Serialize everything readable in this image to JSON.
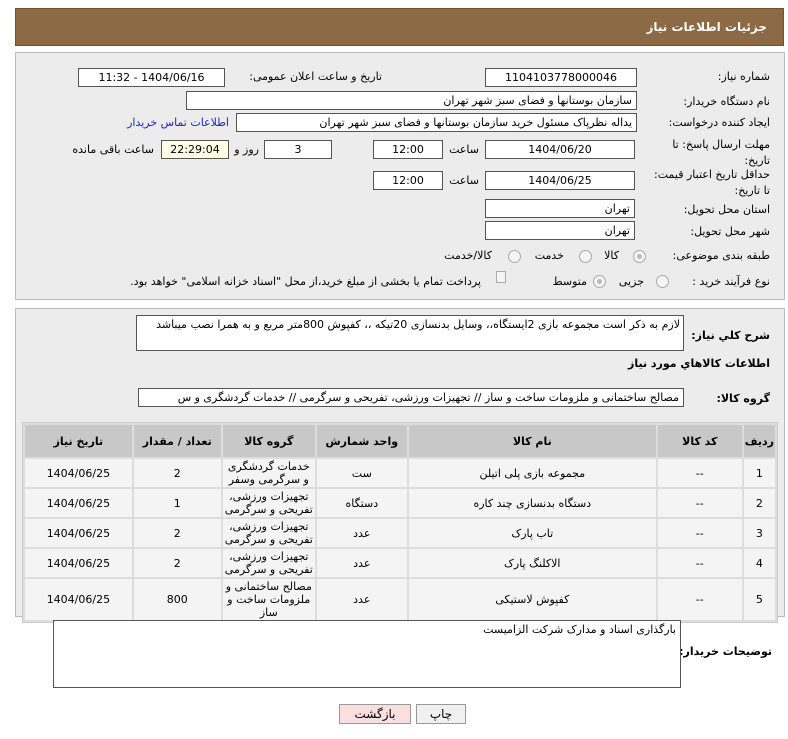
{
  "header": {
    "title": "جزئیات اطلاعات نیاز"
  },
  "form": {
    "need_number_label": "شماره نیاز:",
    "need_number": "1104103778000046",
    "announce_label": "تاریخ و ساعت اعلان عمومی:",
    "announce_value": "1404/06/16 - 11:32",
    "buyer_label": "نام دستگاه خریدار:",
    "buyer": "سازمان بوستانها و فضای سبز شهر تهران",
    "creator_label": "ایجاد کننده درخواست:",
    "creator": "یداله نظرپاک مسئول خرید سازمان بوستانها و فضای سبز شهر تهران",
    "contact_link": "اطلاعات تماس خریدار",
    "deadline_label": "مهلت ارسال پاسخ: تا تاریخ:",
    "deadline_date": "1404/06/20",
    "time_label": "ساعت",
    "deadline_time": "12:00",
    "days": "3",
    "days_label": "روز و",
    "remaining": "22:29:04",
    "remaining_label": "ساعت باقی مانده",
    "validity_label": "حداقل تاریخ اعتبار قیمت: تا تاریخ:",
    "validity_date": "1404/06/25",
    "validity_time": "12:00",
    "province_label": "استان محل تحویل:",
    "province": "تهران",
    "city_label": "شهر محل تحویل:",
    "city": "تهران",
    "category_label": "طبقه بندی موضوعی:",
    "category_options": [
      "کالا",
      "خدمت",
      "کالا/خدمت"
    ],
    "process_label": "نوع فرآیند خرید :",
    "process_options": [
      "جزیی",
      "متوسط"
    ],
    "payment_note": "پرداخت تمام یا بخشی از مبلغ خرید،از محل \"اسناد خزانه اسلامی\" خواهد بود."
  },
  "details": {
    "desc_label": "شرح کلي نیاز:",
    "desc": "لازم به ذکر است مجموعه بازی 2ایستگاه،، وسایل بدنسازی 20تیکه ،، کفپوش 800متر مربع و به همرا نصب میباشد",
    "goods_title": "اطلاعات کالاهاي مورد نیاز",
    "group_label": "گروه کالا:",
    "group": "مصالح ساختمانی و ملزومات ساخت و ساز // تجهیزات ورزشی، تفریحی و سرگرمی // خدمات گردشگری و س",
    "columns": [
      "ردیف",
      "کد کالا",
      "نام کالا",
      "واحد شمارش",
      "گروه کالا",
      "تعداد / مقدار",
      "تاریخ نیاز"
    ],
    "rows": [
      [
        "1",
        "--",
        "مجموعه بازی پلی اتیلن",
        "ست",
        "خدمات گردشگری و سرگرمی وسفر",
        "2",
        "1404/06/25"
      ],
      [
        "2",
        "--",
        "دستگاه بدنسازی چند کاره",
        "دستگاه",
        "تجهیزات ورزشی، تفریحی و سرگرمی",
        "1",
        "1404/06/25"
      ],
      [
        "3",
        "--",
        "تاب پارک",
        "عدد",
        "تجهیزات ورزشی، تفریحی و سرگرمی",
        "2",
        "1404/06/25"
      ],
      [
        "4",
        "--",
        "الاکلنگ پارک",
        "عدد",
        "تجهیزات ورزشی، تفریحی و سرگرمی",
        "2",
        "1404/06/25"
      ],
      [
        "5",
        "--",
        "کفپوش لاستیکی",
        "عدد",
        "مصالح ساختمانی و ملزومات ساخت و ساز",
        "800",
        "1404/06/25"
      ]
    ]
  },
  "notes": {
    "label": "توضیحات خریدار:",
    "value": "بارگذاری اسناد و مدارک شرکت الزامیست"
  },
  "buttons": {
    "print": "چاپ",
    "back": "بازگشت"
  }
}
